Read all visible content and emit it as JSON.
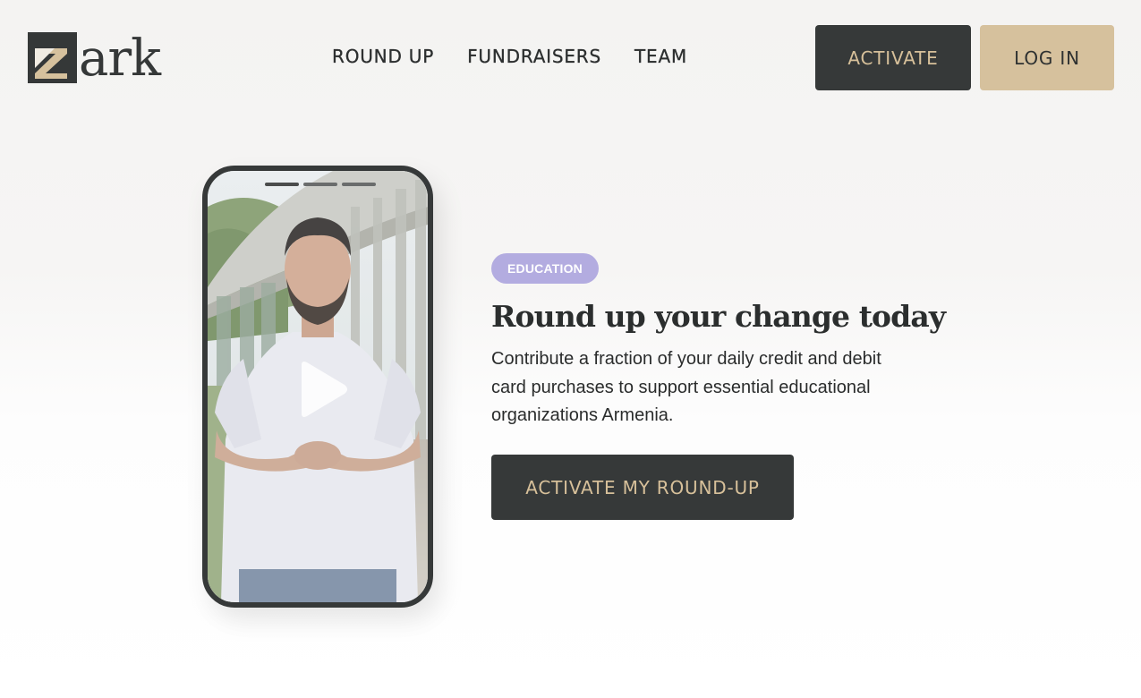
{
  "brand": {
    "logo_text": "ark",
    "logo_mark_letter": "z"
  },
  "nav": {
    "items": [
      {
        "label": "ROUND UP"
      },
      {
        "label": "FUNDRAISERS"
      },
      {
        "label": "TEAM"
      }
    ]
  },
  "header": {
    "activate_label": "ACTIVATE",
    "login_label": "LOG IN"
  },
  "video": {
    "play_icon": "play-icon",
    "story_segments": 3
  },
  "hero": {
    "badge": "EDUCATION",
    "title": "Round up your change today",
    "body": "Contribute a fraction of your daily credit and debit card purchases to support essential educational organizations Armenia.",
    "cta_label": "ACTIVATE MY ROUND-UP"
  },
  "colors": {
    "dark": "#363939",
    "gold": "#d7c09a",
    "login_bg": "#d6c19d",
    "badge_bg": "#b3ace0"
  }
}
